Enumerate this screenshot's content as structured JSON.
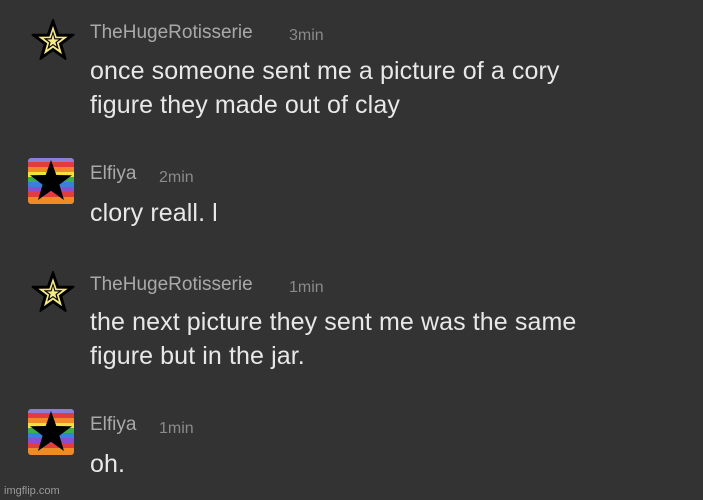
{
  "colors": {
    "background": "#333333",
    "username": "#a9a9a9",
    "timestamp": "#8a8a8a",
    "message_text": "#e8e8e8",
    "star_fill": "#f5e98a",
    "star_outline": "#000000"
  },
  "messages": [
    {
      "username": "TheHugeRotisserie",
      "time": "3min",
      "avatar_icon": "star-outline-icon",
      "lines": [
        "once someone sent me a picture of a cory",
        "figure they made out of clay"
      ]
    },
    {
      "username": "Elfiya",
      "time": "2min",
      "avatar_icon": "rainbow-star-icon",
      "lines": [
        "clory reall. l"
      ]
    },
    {
      "username": "TheHugeRotisserie",
      "time": "1min",
      "avatar_icon": "star-outline-icon",
      "lines": [
        "the next picture they sent me was the same",
        "figure but in the jar."
      ]
    },
    {
      "username": "Elfiya",
      "time": "1min",
      "avatar_icon": "rainbow-star-icon",
      "lines": [
        "oh."
      ]
    }
  ],
  "watermark": "imgflip.com"
}
